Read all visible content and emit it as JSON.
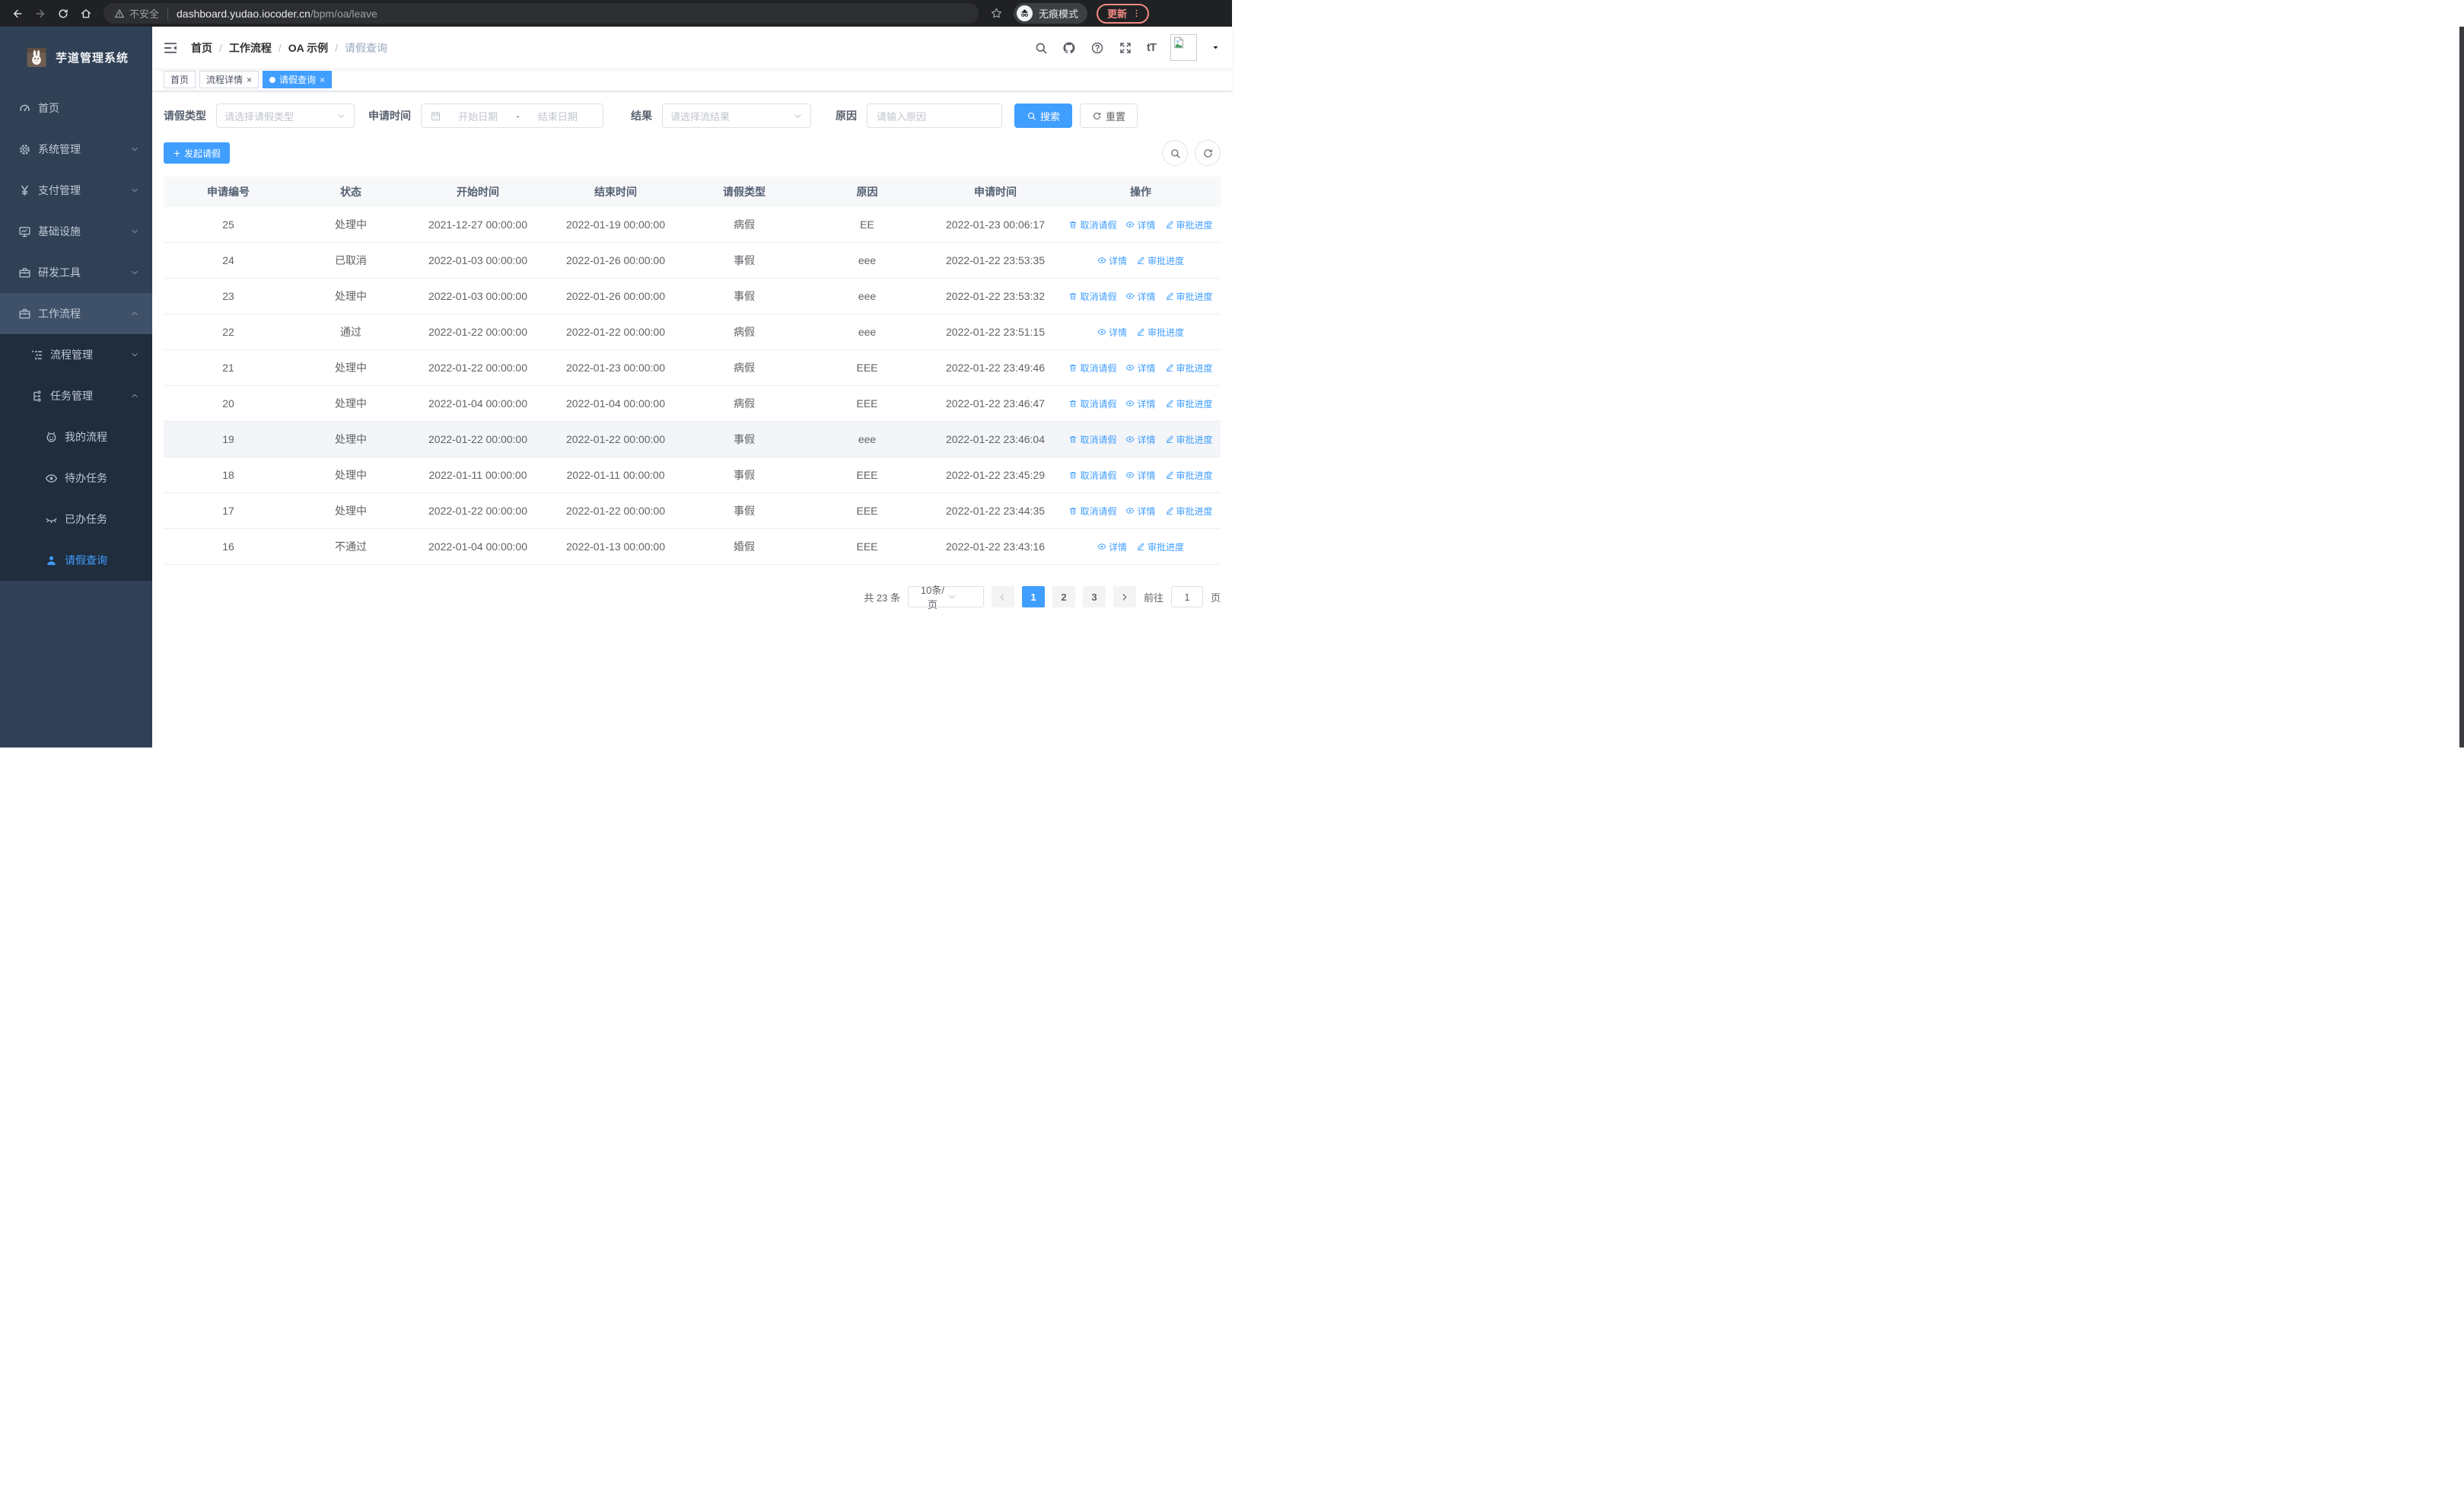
{
  "colors": {
    "accent": "#409eff",
    "sidebar_bg": "#304156",
    "submenu_bg": "#1f2d3d",
    "update_badge": "#f28b82"
  },
  "browser": {
    "security_text": "不安全",
    "url_host": "dashboard.yudao.iocoder.cn",
    "url_path": "/bpm/oa/leave",
    "incognito_label": "无痕模式",
    "update_label": "更新"
  },
  "sidebar": {
    "app_title": "芋道管理系统",
    "items": [
      {
        "key": "home",
        "icon": "gauge",
        "label": "首页",
        "level": 1
      },
      {
        "key": "system-mgmt",
        "icon": "gear",
        "label": "系统管理",
        "level": 1,
        "caret": "down"
      },
      {
        "key": "payment-mgmt",
        "icon": "yen",
        "label": "支付管理",
        "level": 1,
        "caret": "down"
      },
      {
        "key": "infrastructure",
        "icon": "monitor",
        "label": "基础设施",
        "level": 1,
        "caret": "down"
      },
      {
        "key": "dev-tools",
        "icon": "toolbox",
        "label": "研发工具",
        "level": 1,
        "caret": "down"
      },
      {
        "key": "workflow",
        "icon": "briefcase",
        "label": "工作流程",
        "level": 1,
        "caret": "up",
        "expanded_parent": true
      },
      {
        "key": "process-mgmt",
        "icon": "list",
        "label": "流程管理",
        "level": 2,
        "caret": "down",
        "in_submenu": true
      },
      {
        "key": "task-mgmt",
        "icon": "flow",
        "label": "任务管理",
        "level": 2,
        "caret": "up",
        "in_submenu": true
      },
      {
        "key": "my-process",
        "icon": "face",
        "label": "我的流程",
        "level": 3,
        "in_submenu": true
      },
      {
        "key": "todo-tasks",
        "icon": "eye",
        "label": "待办任务",
        "level": 3,
        "in_submenu": true
      },
      {
        "key": "done-tasks",
        "icon": "eyeclosed",
        "label": "已办任务",
        "level": 3,
        "in_submenu": true
      },
      {
        "key": "leave-query",
        "icon": "user",
        "label": "请假查询",
        "level": 3,
        "in_submenu": true,
        "active": true
      }
    ]
  },
  "header": {
    "breadcrumb": [
      "首页",
      "工作流程",
      "OA 示例",
      "请假查询"
    ]
  },
  "tabs": [
    {
      "label": "首页",
      "closable": false,
      "active": false
    },
    {
      "label": "流程详情",
      "closable": true,
      "active": false
    },
    {
      "label": "请假查询",
      "closable": true,
      "active": true
    }
  ],
  "filters": {
    "type_label": "请假类型",
    "type_placeholder": "请选择请假类型",
    "time_label": "申请时间",
    "start_placeholder": "开始日期",
    "range_separator": "-",
    "end_placeholder": "结束日期",
    "result_label": "结果",
    "result_placeholder": "请选择流结果",
    "reason_label": "原因",
    "reason_placeholder": "请输入原因",
    "search_label": "搜索",
    "reset_label": "重置"
  },
  "toolbar": {
    "create_label": "发起请假"
  },
  "table": {
    "columns": [
      "申请编号",
      "状态",
      "开始时间",
      "结束时间",
      "请假类型",
      "原因",
      "申请时间",
      "操作"
    ],
    "action_labels": {
      "cancel": "取消请假",
      "detail": "详情",
      "progress": "审批进度"
    },
    "rows": [
      {
        "id": "25",
        "status": "处理中",
        "start": "2021-12-27 00:00:00",
        "end": "2022-01-19 00:00:00",
        "type": "病假",
        "reason": "EE",
        "apply_time": "2022-01-23 00:06:17",
        "actions": [
          "cancel",
          "detail",
          "progress"
        ]
      },
      {
        "id": "24",
        "status": "已取消",
        "start": "2022-01-03 00:00:00",
        "end": "2022-01-26 00:00:00",
        "type": "事假",
        "reason": "eee",
        "apply_time": "2022-01-22 23:53:35",
        "actions": [
          "detail",
          "progress"
        ]
      },
      {
        "id": "23",
        "status": "处理中",
        "start": "2022-01-03 00:00:00",
        "end": "2022-01-26 00:00:00",
        "type": "事假",
        "reason": "eee",
        "apply_time": "2022-01-22 23:53:32",
        "actions": [
          "cancel",
          "detail",
          "progress"
        ]
      },
      {
        "id": "22",
        "status": "通过",
        "start": "2022-01-22 00:00:00",
        "end": "2022-01-22 00:00:00",
        "type": "病假",
        "reason": "eee",
        "apply_time": "2022-01-22 23:51:15",
        "actions": [
          "detail",
          "progress"
        ]
      },
      {
        "id": "21",
        "status": "处理中",
        "start": "2022-01-22 00:00:00",
        "end": "2022-01-23 00:00:00",
        "type": "病假",
        "reason": "EEE",
        "apply_time": "2022-01-22 23:49:46",
        "actions": [
          "cancel",
          "detail",
          "progress"
        ]
      },
      {
        "id": "20",
        "status": "处理中",
        "start": "2022-01-04 00:00:00",
        "end": "2022-01-04 00:00:00",
        "type": "病假",
        "reason": "EEE",
        "apply_time": "2022-01-22 23:46:47",
        "actions": [
          "cancel",
          "detail",
          "progress"
        ]
      },
      {
        "id": "19",
        "status": "处理中",
        "start": "2022-01-22 00:00:00",
        "end": "2022-01-22 00:00:00",
        "type": "事假",
        "reason": "eee",
        "apply_time": "2022-01-22 23:46:04",
        "actions": [
          "cancel",
          "detail",
          "progress"
        ],
        "hovered": true
      },
      {
        "id": "18",
        "status": "处理中",
        "start": "2022-01-11 00:00:00",
        "end": "2022-01-11 00:00:00",
        "type": "事假",
        "reason": "EEE",
        "apply_time": "2022-01-22 23:45:29",
        "actions": [
          "cancel",
          "detail",
          "progress"
        ]
      },
      {
        "id": "17",
        "status": "处理中",
        "start": "2022-01-22 00:00:00",
        "end": "2022-01-22 00:00:00",
        "type": "事假",
        "reason": "EEE",
        "apply_time": "2022-01-22 23:44:35",
        "actions": [
          "cancel",
          "detail",
          "progress"
        ]
      },
      {
        "id": "16",
        "status": "不通过",
        "start": "2022-01-04 00:00:00",
        "end": "2022-01-13 00:00:00",
        "type": "婚假",
        "reason": "EEE",
        "apply_time": "2022-01-22 23:43:16",
        "actions": [
          "detail",
          "progress"
        ]
      }
    ]
  },
  "pagination": {
    "total": "共 23 条",
    "page_size": "10条/页",
    "pages": [
      "1",
      "2",
      "3"
    ],
    "active_page": "1",
    "goto_label": "前往",
    "goto_value": "1",
    "page_unit": "页"
  }
}
